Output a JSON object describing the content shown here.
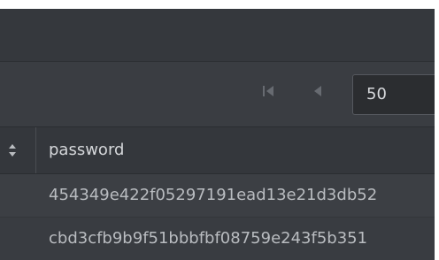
{
  "pager": {
    "page_size_value": "50",
    "first_icon": "skip-to-first-icon",
    "prev_icon": "previous-page-icon"
  },
  "table": {
    "sort_icon": "sort-updown-icon",
    "columns": [
      {
        "label": "password"
      }
    ],
    "rows": [
      {
        "password": "454349e422f05297191ead13e21d3db52"
      },
      {
        "password": "cbd3cfb9b9f51bbbfbf08759e243f5b351"
      }
    ]
  },
  "colors": {
    "background": "#3a3d42",
    "text": "#d5d7da",
    "muted_icon": "#6b6f75"
  }
}
